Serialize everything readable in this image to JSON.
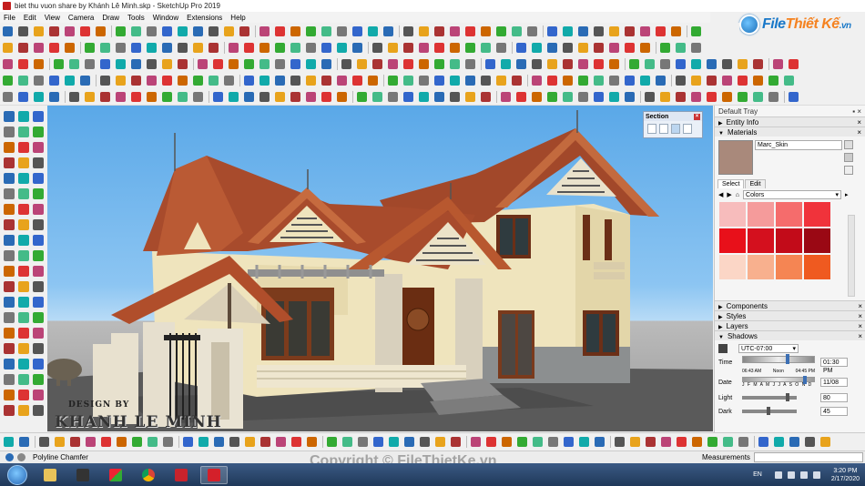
{
  "window": {
    "title": "biet thu vuon share by Khánh Lê Minh.skp - SketchUp Pro 2019"
  },
  "menu": [
    "File",
    "Edit",
    "View",
    "Camera",
    "Draw",
    "Tools",
    "Window",
    "Extensions",
    "Help"
  ],
  "logo": {
    "part1": "File",
    "part2": "Thiết Kế",
    "part3": ".vn"
  },
  "section_panel": {
    "title": "Section"
  },
  "viewport": {
    "design_by": "DESIGN BY",
    "designer": "KHANH LE MINH"
  },
  "tray": {
    "title": "Default Tray",
    "entity_info": "Entity Info",
    "materials": "Materials",
    "material_name": "Marc_Skin",
    "tab_select": "Select",
    "tab_edit": "Edit",
    "library": "Colors",
    "components": "Components",
    "styles": "Styles",
    "layers": "Layers",
    "shadows": "Shadows",
    "timezone": "UTC-07:00",
    "time_label": "Time",
    "time_start": "06:43 AM",
    "time_noon": "Noon",
    "time_end": "04:45 PM",
    "time_value": "01:30 PM",
    "date_label": "Date",
    "months": "J F M A M J J A S O N D",
    "date_value": "11/08",
    "light_label": "Light",
    "light_value": "80",
    "dark_label": "Dark",
    "dark_value": "45",
    "swatches": [
      "#f7bcbc",
      "#f59b9b",
      "#f56c6c",
      "#f0333b",
      "#e8101a",
      "#d4101e",
      "#c20b19",
      "#9a0814",
      "#fbd6c6",
      "#f8b08e",
      "#f58553",
      "#ef5a20"
    ]
  },
  "status": {
    "text": "Polyline Chamfer",
    "measurements": "Measurements"
  },
  "copyright": "Copyright © FileThietKe.vn",
  "taskbar": {
    "language": "EN",
    "time": "3:20 PM",
    "date": "2/17/2020"
  }
}
